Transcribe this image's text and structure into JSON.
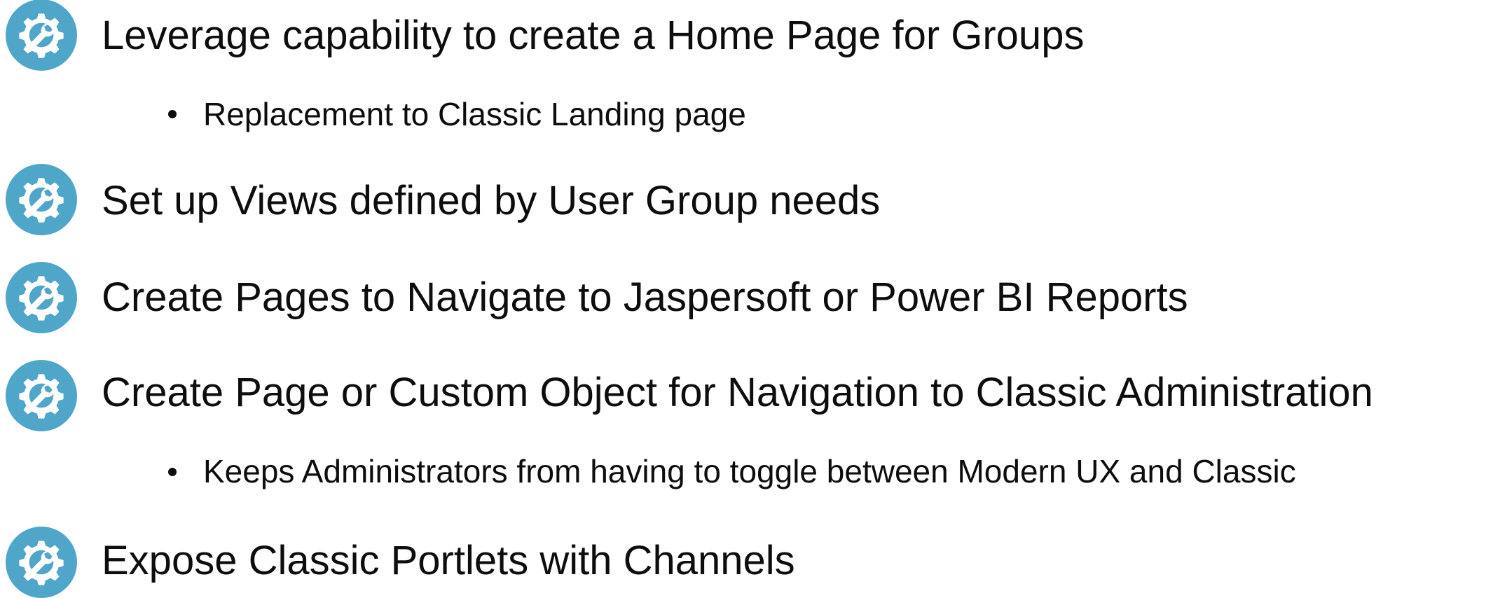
{
  "items": [
    {
      "icon": "gear-wrench-icon",
      "text": "Leverage capability to create a Home Page for Groups",
      "sub": "Replacement to Classic Landing page"
    },
    {
      "icon": "gear-wrench-icon",
      "text": "Set up Views defined by User Group needs"
    },
    {
      "icon": "gear-wrench-icon",
      "text": "Create Pages to Navigate to Jaspersoft or Power BI Reports"
    },
    {
      "icon": "gear-wrench-icon",
      "text": "Create Page or Custom Object for Navigation to Classic Administration",
      "sub": "Keeps Administrators from having to toggle between Modern UX and Classic"
    },
    {
      "icon": "gear-wrench-icon",
      "text": "Expose Classic Portlets with Channels"
    }
  ],
  "colors": {
    "icon_circle": "#4fa6c9",
    "icon_glyph": "#ffffff",
    "text": "#0d0d0d"
  }
}
